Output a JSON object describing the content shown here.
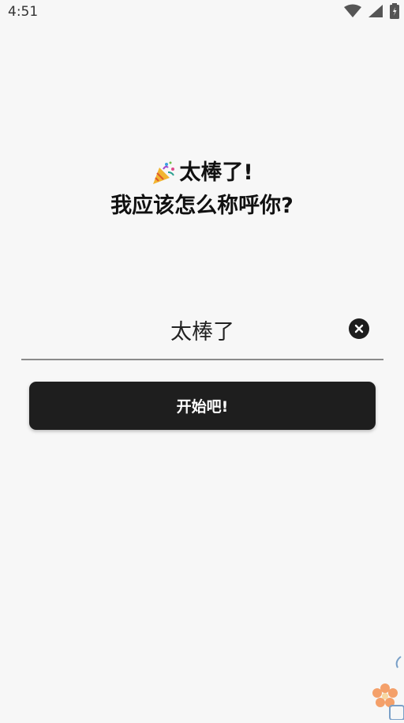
{
  "status_bar": {
    "time": "4:51",
    "icons": [
      "wifi-icon",
      "signal-icon",
      "battery-icon"
    ]
  },
  "heading": {
    "icon": "party-popper-icon",
    "line1": "太棒了!",
    "line2": "我应该怎么称呼你?"
  },
  "name_field": {
    "value": "太棒了",
    "clear_icon": "clear-icon"
  },
  "start_button": {
    "label": "开始吧!"
  },
  "floating_widget": {
    "icon": "flower-icon",
    "accent": "#f4a06a"
  },
  "colors": {
    "background": "#f7f7f7",
    "button": "#1e1e1e",
    "button_text": "#ffffff",
    "underline": "#8a8a8a"
  }
}
